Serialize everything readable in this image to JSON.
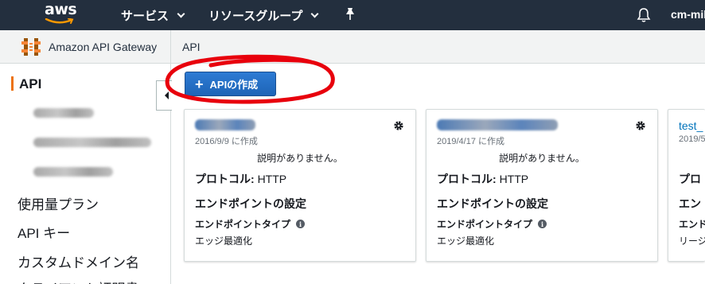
{
  "topnav": {
    "logo_text": "aws",
    "services_label": "サービス",
    "resource_groups_label": "リソースグループ",
    "user_label": "cm-mik"
  },
  "breadcrumb": {
    "service_name": "Amazon API Gateway",
    "current": "API"
  },
  "sidebar": {
    "title": "API",
    "links": [
      "使用量プラン",
      "API キー",
      "カスタムドメイン名",
      "クライアント証明書"
    ]
  },
  "create_button": {
    "label": "APIの作成"
  },
  "cards": [
    {
      "name": "",
      "date": "2016/9/9 に作成",
      "description": "説明がありません。",
      "protocol_label": "プロトコル:",
      "protocol_value": "HTTP",
      "endpoint_heading": "エンドポイントの設定",
      "endpoint_type_label": "エンドポイントタイプ",
      "endpoint_type_value": "エッジ最適化"
    },
    {
      "name": "",
      "date": "2019/4/17 に作成",
      "description": "説明がありません。",
      "protocol_label": "プロトコル:",
      "protocol_value": "HTTP",
      "endpoint_heading": "エンドポイントの設定",
      "endpoint_type_label": "エンドポイントタイプ",
      "endpoint_type_value": "エッジ最適化"
    },
    {
      "name": "test_",
      "date": "2019/5",
      "description": "",
      "protocol_label": "プロ",
      "protocol_value": "",
      "endpoint_heading": "エン",
      "endpoint_type_label": "エンド",
      "endpoint_type_value": "リージ"
    }
  ],
  "icons": {
    "services_dropdown": "chevron-down-icon",
    "resource_groups_dropdown": "chevron-down-icon",
    "pin": "pin-icon",
    "notifications": "bell-icon",
    "service": "api-gateway-icon",
    "card_settings": "gear-icon",
    "info": "info-icon",
    "collapse": "caret-left-icon"
  },
  "colors": {
    "nav_bg": "#232f3e",
    "accent_orange": "#ec7211",
    "primary_button": "#1e64b7",
    "link": "#0073bb",
    "annotation_red": "#e8000c"
  }
}
